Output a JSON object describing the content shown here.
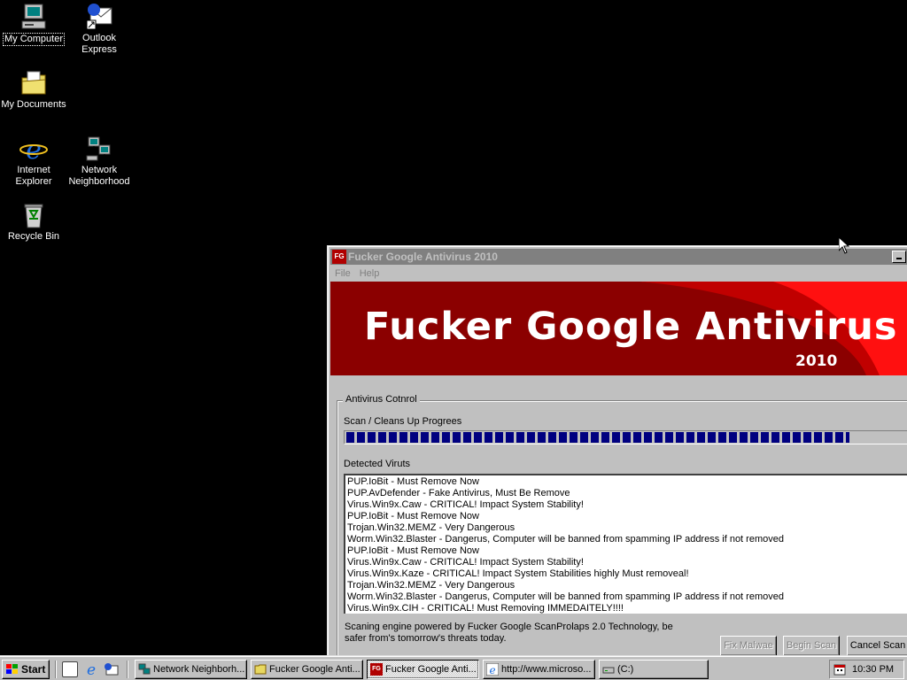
{
  "desktop": {
    "icons": [
      {
        "label": "My Computer",
        "icon": "my-computer-icon"
      },
      {
        "label": "Outlook Express",
        "icon": "outlook-express-icon"
      },
      {
        "label": "My Documents",
        "icon": "my-documents-icon"
      },
      {
        "label": "Internet Explorer",
        "icon": "internet-explorer-icon"
      },
      {
        "label": "Network Neighborhood",
        "icon": "network-neighborhood-icon"
      },
      {
        "label": "Recycle Bin",
        "icon": "recycle-bin-icon"
      }
    ]
  },
  "window": {
    "app_icon_text": "FG",
    "title": "Fucker Google Antivirus 2010",
    "menu": [
      "File",
      "Help"
    ],
    "banner_title": "Fucker Google Antivirus",
    "banner_year": "2010",
    "group_label": "Antivirus Cotnrol",
    "progress_label": "Scan / Cleans Up Progrees",
    "progress_value": 0.88,
    "detected_label": "Detected Viruts",
    "detected": [
      "PUP.IoBit - Must Remove Now",
      "PUP.AvDefender - Fake Antivirus, Must Be Remove",
      "Virus.Win9x.Caw - CRITICAL! Impact System Stability!",
      "PUP.IoBit - Must Remove Now",
      "Trojan.Win32.MEMZ - Very Dangerous",
      "Worm.Win32.Blaster - Dangerus, Computer will be banned from spamming IP address if not removed",
      "PUP.IoBit - Must Remove Now",
      "Virus.Win9x.Caw - CRITICAL! Impact System Stability!",
      "Virus.Win9x.Kaze - CRITICAL! Impact System Stabilities highly Must removeal!",
      "Trojan.Win32.MEMZ - Very Dangerous",
      "Worm.Win32.Blaster - Dangerus, Computer will be banned from spamming IP address if not removed",
      "Virus.Win9x.CIH - CRITICAL! Must Removing IMMEDAITELY!!!!"
    ],
    "footer_text": "Scaning engine powered by Fucker Google ScanProlaps 2.0 Technology, be safer from's tomorrow's threats today.",
    "buttons": {
      "fix": "Fix Malwae",
      "begin": "Begin Scan",
      "cancel": "Cancel Scan"
    }
  },
  "taskbar": {
    "start_label": "Start",
    "tasks": [
      "Network Neighborh...",
      "Fucker Google Anti...",
      "Fucker Google Anti...",
      "http://www.microso...",
      "(C:)"
    ],
    "clock": "10:30 PM"
  }
}
